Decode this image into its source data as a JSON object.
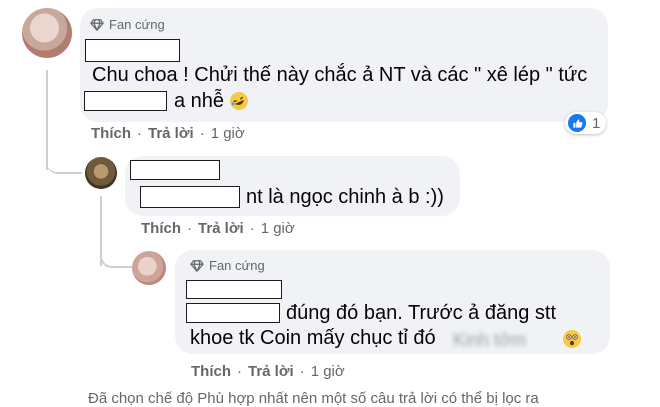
{
  "comment1": {
    "badge": "Fan cứng",
    "line1": "Chu choa ! Chửi thế này chắc ả NT và các \" xê lép \" tức",
    "line2_tail": "a nhễ",
    "emoji": "rolling-laughing-emoji",
    "actions": {
      "like": "Thích",
      "reply": "Trả lời",
      "time": "1 giờ"
    },
    "reactions": {
      "icon": "like-icon",
      "count": "1"
    }
  },
  "comment2": {
    "text": "nt là ngọc chinh à b :))",
    "actions": {
      "like": "Thích",
      "reply": "Trả lời",
      "time": "1 giờ"
    }
  },
  "comment3": {
    "badge": "Fan cứng",
    "line1": "đúng đó bạn. Trước ả đăng stt",
    "line2": "khoe tk Coin mấy chục tỉ đó",
    "blurred": "Kinh tởm",
    "emoji": "astonished-face-emoji",
    "actions": {
      "like": "Thích",
      "reply": "Trả lời",
      "time": "1 giờ"
    }
  },
  "footer": {
    "text": "Đã chọn chế độ Phù hợp nhất nên một số câu trả lời có thể bị lọc ra"
  },
  "colors": {
    "bubble": "#f0f2f5",
    "meta": "#65676b",
    "like": "#1877f2"
  }
}
